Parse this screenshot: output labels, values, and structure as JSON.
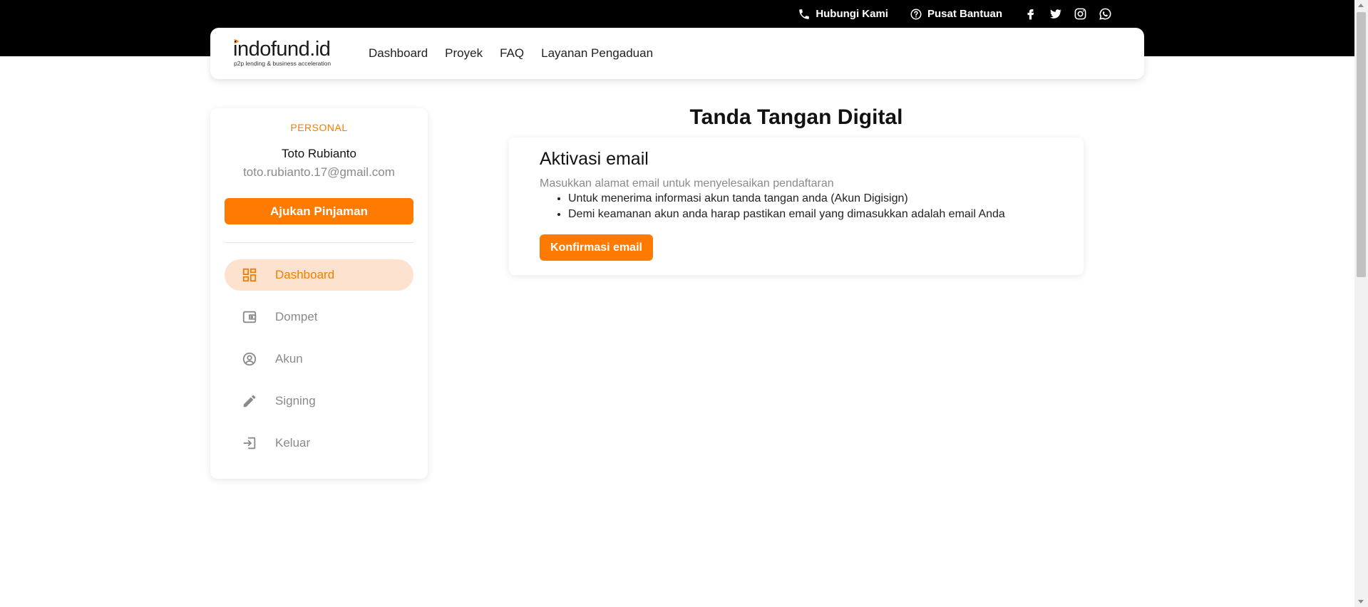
{
  "topbar": {
    "contact_label": "Hubungi Kami",
    "help_label": "Pusat Bantuan",
    "socials": [
      "facebook-icon",
      "twitter-icon",
      "instagram-icon",
      "whatsapp-icon"
    ]
  },
  "brand": {
    "name": "indofund.id",
    "tagline": "p2p lending & business acceleration",
    "accent_color": "#ff7a00"
  },
  "nav": {
    "items": [
      "Dashboard",
      "Proyek",
      "FAQ",
      "Layanan Pengaduan"
    ]
  },
  "sidebar": {
    "account_type": "PERSONAL",
    "user_name": "Toto Rubianto",
    "user_email": "toto.rubianto.17@gmail.com",
    "loan_button": "Ajukan Pinjaman",
    "menu": [
      {
        "label": "Dashboard",
        "icon": "dashboard-icon",
        "active": true
      },
      {
        "label": "Dompet",
        "icon": "wallet-icon",
        "active": false
      },
      {
        "label": "Akun",
        "icon": "account-icon",
        "active": false
      },
      {
        "label": "Signing",
        "icon": "pencil-icon",
        "active": false
      },
      {
        "label": "Keluar",
        "icon": "logout-icon",
        "active": false
      }
    ]
  },
  "main": {
    "page_title": "Tanda Tangan Digital",
    "card": {
      "title": "Aktivasi email",
      "description": "Masukkan alamat email untuk menyelesaikan pendaftaran",
      "bullets": [
        "Untuk menerima informasi akun tanda tangan anda (Akun Digisign)",
        "Demi keamanan akun anda harap pastikan email yang dimasukkan adalah email Anda"
      ],
      "confirm_button": "Konfirmasi email"
    }
  }
}
